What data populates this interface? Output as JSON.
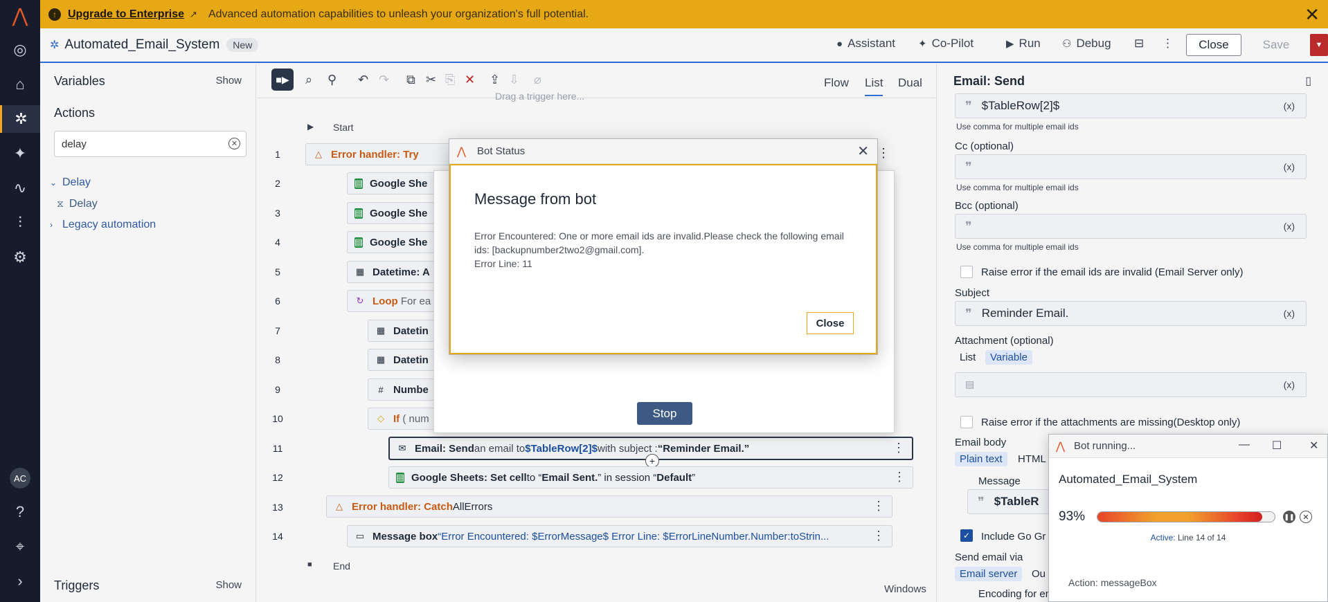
{
  "banner": {
    "link": "Upgrade to Enterprise",
    "text": "Advanced automation capabilities to unleash your organization's full potential."
  },
  "rail": {
    "avatar": "AC",
    "icons": [
      "automation-anywhere-logo-icon",
      "explore-icon",
      "home-icon",
      "automation-icon",
      "ai-icon",
      "activity-icon",
      "manage-icon",
      "settings-icon",
      "help-icon",
      "location-icon",
      "expand-icon"
    ]
  },
  "header": {
    "title": "Automated_Email_System",
    "badge": "New",
    "assistant": "Assistant",
    "copilot": "Co-Pilot",
    "run": "Run",
    "debug": "Debug",
    "close": "Close",
    "save": "Save"
  },
  "left": {
    "variables": "Variables",
    "variables_show": "Show",
    "actions": "Actions",
    "search_value": "delay",
    "tree": [
      "Delay",
      "Delay",
      "Legacy automation"
    ],
    "triggers": "Triggers",
    "triggers_show": "Show"
  },
  "canvas": {
    "tabs": [
      "Flow",
      "List",
      "Dual"
    ],
    "drag_hint": "Drag a trigger here...",
    "start": "Start",
    "end": "End",
    "windows": "Windows",
    "lines": [
      "1",
      "2",
      "3",
      "4",
      "5",
      "6",
      "7",
      "8",
      "9",
      "10",
      "11",
      "12",
      "13",
      "14"
    ],
    "n1": "Error handler: Try",
    "n2": "Google She",
    "n3": "Google She",
    "n4": "Google She",
    "n5": "Datetime: A",
    "n6a": "Loop",
    "n6b": "For ea",
    "n7": "Datetin",
    "n8": "Datetin",
    "n9": "Numbe",
    "n10a": "If",
    "n10b": "( num",
    "n11a": "Email: Send",
    "n11b": " an email to ",
    "n11c": "$TableRow[2]$",
    "n11d": " with subject : ",
    "n11e": "“Reminder Email.”",
    "n12a": "Google Sheets: Set cell",
    "n12b": " to “",
    "n12c": "Email Sent.",
    "n12d": "” in session “",
    "n12e": "Default",
    "n12f": "”",
    "n13a": "Error handler: Catch",
    "n13b": " AllErrors",
    "n14a": "Message box",
    "n14b": " “Error Encountered: $ErrorMessage$ Error Line: $ErrorLineNumber.Number:toStrin..."
  },
  "right": {
    "title": "Email: Send",
    "to_value": "$TableRow[2]$",
    "hint": "Use comma for multiple email ids",
    "cc": "Cc (optional)",
    "bcc": "Bcc (optional)",
    "raise1": "Raise error if the email ids are invalid (Email Server only)",
    "subject": "Subject",
    "subject_value": "Reminder Email.",
    "attachment": "Attachment (optional)",
    "att_tabs": [
      "List",
      "Variable"
    ],
    "raise2": "Raise error if the attachments are missing(Desktop only)",
    "body": "Email body",
    "body_tabs": [
      "Plain text",
      "HTML"
    ],
    "message": "Message",
    "message_value": "$TableR",
    "include": "Include Go Gr",
    "send_via": "Send email via",
    "send_tabs": [
      "Email server",
      "Ou"
    ],
    "encoding": "Encoding for email (optional)"
  },
  "backdrop": {
    "stop": "Stop"
  },
  "dialog": {
    "title": "Bot Status",
    "heading": "Message from bot",
    "line1": "Error Encountered: One or more email ids are invalid.Please check the following email ids: [backupnumber2two2@gmail.com].",
    "line2": "Error Line: 11",
    "close": "Close"
  },
  "runwin": {
    "title": "Bot running...",
    "name": "Automated_Email_System",
    "percent": "93%",
    "progress": 0.93,
    "active_label": "Active:",
    "active_value": "Line 14 of 14",
    "action": "Action: messageBox"
  }
}
